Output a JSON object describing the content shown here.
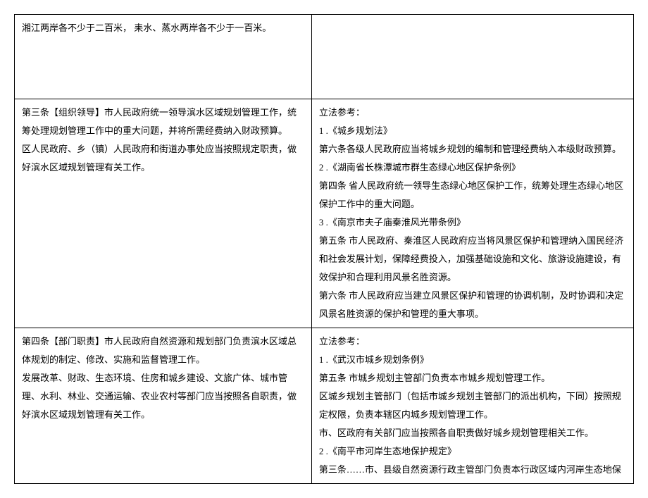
{
  "rows": [
    {
      "left": [
        "湘江两岸各不少于二百米，  耒水、蒸水两岸各不少于一百米。"
      ],
      "right": []
    },
    {
      "left": [
        "        第三条【组织领导】市人民政府统一领导滨水区域规划管理工作，统筹处理规划管理工作中的重大问题，并将所需经费纳入财政预算。",
        "        区人民政府、乡（镇）人民政府和街道办事处应当按照规定职责，做好滨水区域规划管理有关工作。"
      ],
      "right": [
        "立法参考：",
        "1            .《城乡规划法》",
        "第六条各级人民政府应当将城乡规划的编制和管理经费纳入本级财政预算。",
        "2 .《湖南省长株潭城市群生态绿心地区保护条例》",
        "第四条 省人民政府统一领导生态绿心地区保护工作，统筹处理生态绿心地区保护工作中的重大问题。",
        "3            .《南京市夫子庙秦淮风光带条例》",
        "第五条 市人民政府、秦淮区人民政府应当将风景区保护和管理纳入国民经济和社会发展计划，保障经费投入，加强基础设施和文化、旅游设施建设，有效保护和合理利用风景名胜资源。",
        "第六条 市人民政府应当建立风景区保护和管理的协调机制，及时协调和决定风景名胜资源的保护和管理的重大事项。"
      ]
    },
    {
      "left": [
        "        第四条【部门职责】市人民政府自然资源和规划部门负责滨水区域总体规划的制定、修改、实施和监督管理工作。",
        "        发展改革、财政、生态环境、住房和城乡建设、文旅广体、城市管理、水利、林业、交通运输、农业农村等部门应当按照各自职责，做好滨水区域规划管理有关工作。"
      ],
      "right": [
        "立法参考：",
        "1            .《武汉市城乡规划条例》",
        "第五条 市城乡规划主管部门负责本市城乡规划管理工作。",
        "区城乡规划主管部门（包括市城乡规划主管部门的派出机构，下同）按照规定权限，负责本辖区内城乡规划管理工作。",
        "市、区政府有关部门应当按照各自职责做好城乡规划管理相关工作。",
        "2 .《南平市河岸生态地保护规定》",
        "第三条……市、县级自然资源行政主管部门负责本行政区域内河岸生态地保"
      ]
    }
  ]
}
